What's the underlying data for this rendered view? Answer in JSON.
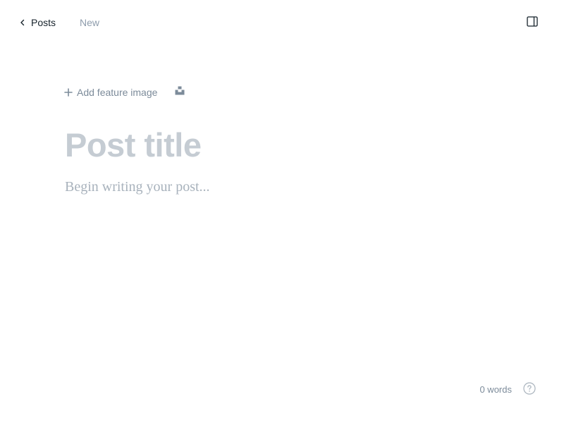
{
  "header": {
    "back_label": "Posts",
    "status": "New",
    "back_icon": "chevron-left-icon",
    "sidebar_toggle_icon": "sidebar-panel-icon"
  },
  "editor": {
    "add_feature_image_label": "Add feature image",
    "plus_icon": "plus-icon",
    "unsplash_icon": "unsplash-icon",
    "title_placeholder": "Post title",
    "title_value": "",
    "body_placeholder": "Begin writing your post...",
    "body_value": ""
  },
  "footer": {
    "word_count": "0 words",
    "help_icon": "help-circle-icon"
  },
  "colors": {
    "text_primary": "#15212a",
    "text_muted": "#8e9cac",
    "placeholder_title": "#c5ccd3",
    "placeholder_body": "#a8b2bc",
    "background": "#ffffff"
  }
}
